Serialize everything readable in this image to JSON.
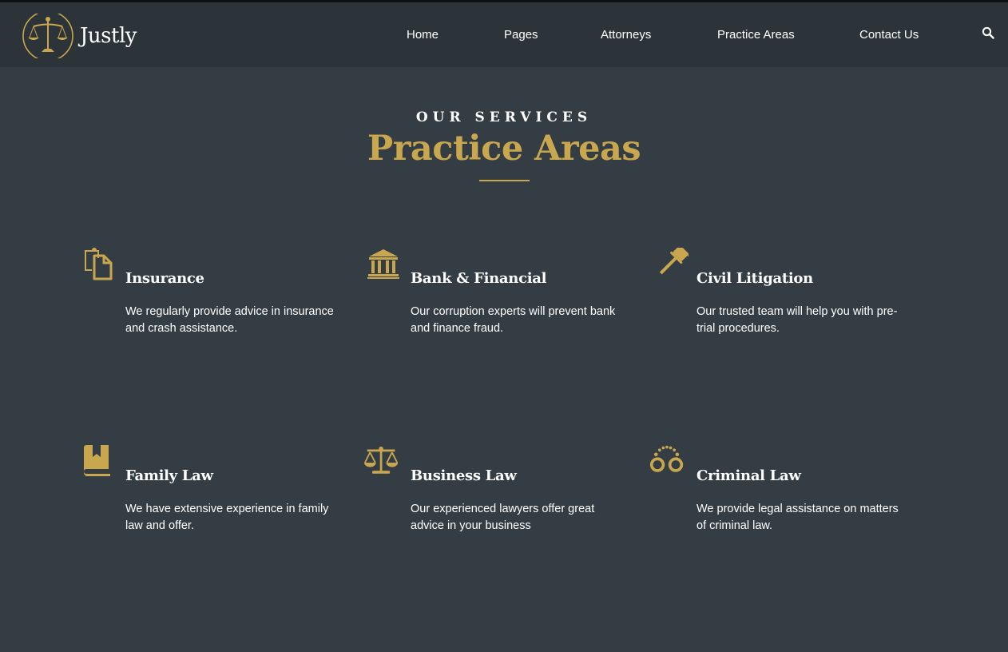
{
  "brand": {
    "name": "Justly",
    "logo_icon": "scales-of-justice-icon"
  },
  "nav": {
    "items": [
      {
        "label": "Home"
      },
      {
        "label": "Pages"
      },
      {
        "label": "Attorneys"
      },
      {
        "label": "Practice Areas"
      },
      {
        "label": "Contact Us"
      }
    ],
    "search_icon": "search-icon"
  },
  "section": {
    "eyebrow": "OUR SERVICES",
    "title": "Practice Areas"
  },
  "practice_areas": [
    {
      "icon": "clipboard-copy-icon",
      "title": "Insurance",
      "text": "We regularly provide advice in insurance and crash assistance."
    },
    {
      "icon": "bank-building-icon",
      "title": "Bank & Financial",
      "text": "Our corruption experts will prevent bank and finance fraud."
    },
    {
      "icon": "gavel-icon",
      "title": "Civil Litigation",
      "text": "Our trusted team will help you with pre-trial procedures."
    },
    {
      "icon": "law-book-icon",
      "title": "Family Law",
      "text": "We have extensive experience in family law and offer."
    },
    {
      "icon": "balance-scale-icon",
      "title": "Business Law",
      "text": "Our experienced lawyers offer great advice in your business"
    },
    {
      "icon": "handcuffs-icon",
      "title": "Criminal Law",
      "text": "We provide legal assistance on matters of criminal law."
    }
  ],
  "colors": {
    "background": "#343d44",
    "header": "#2c343a",
    "accent": "#c9a74e",
    "text": "#ffffff"
  }
}
